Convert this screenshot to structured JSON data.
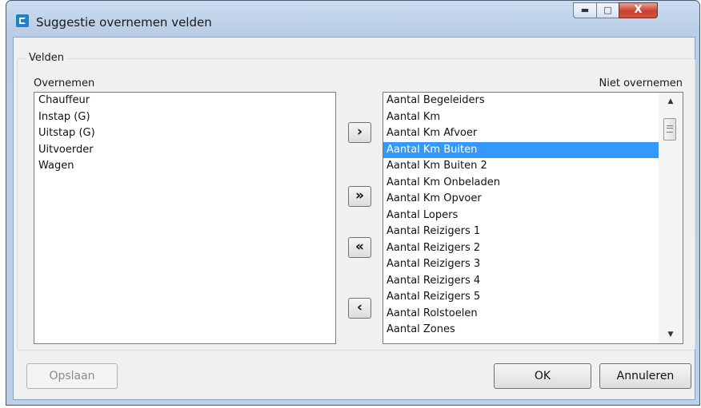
{
  "window": {
    "title": "Suggestie overnemen velden",
    "controls": {
      "minimize_icon": "minimize-icon",
      "maximize_icon": "maximize-icon",
      "close_label": "X"
    }
  },
  "group": {
    "label": "Velden"
  },
  "left_list": {
    "header": "Overnemen",
    "items": [
      "Chauffeur",
      "Instap (G)",
      "Uitstap (G)",
      "Uitvoerder",
      "Wagen"
    ]
  },
  "right_list": {
    "header": "Niet overnemen",
    "selected_index": 3,
    "items": [
      "Aantal Begeleiders",
      "Aantal Km",
      "Aantal Km Afvoer",
      "Aantal Km Buiten",
      "Aantal Km Buiten 2",
      "Aantal Km Onbeladen",
      "Aantal Km Opvoer",
      "Aantal Lopers",
      "Aantal Reizigers 1",
      "Aantal Reizigers 2",
      "Aantal Reizigers 3",
      "Aantal Reizigers 4",
      "Aantal Reizigers 5",
      "Aantal Rolstoelen",
      "Aantal Zones"
    ]
  },
  "move_buttons": {
    "add_one": "›",
    "add_all": "»",
    "remove_all": "«",
    "remove_one": "‹"
  },
  "buttons": {
    "save": "Opslaan",
    "ok": "OK",
    "cancel": "Annuleren"
  },
  "colors": {
    "selection": "#3399ff",
    "titlebar": "#bcd0e8",
    "close_button": "#c8422f"
  }
}
